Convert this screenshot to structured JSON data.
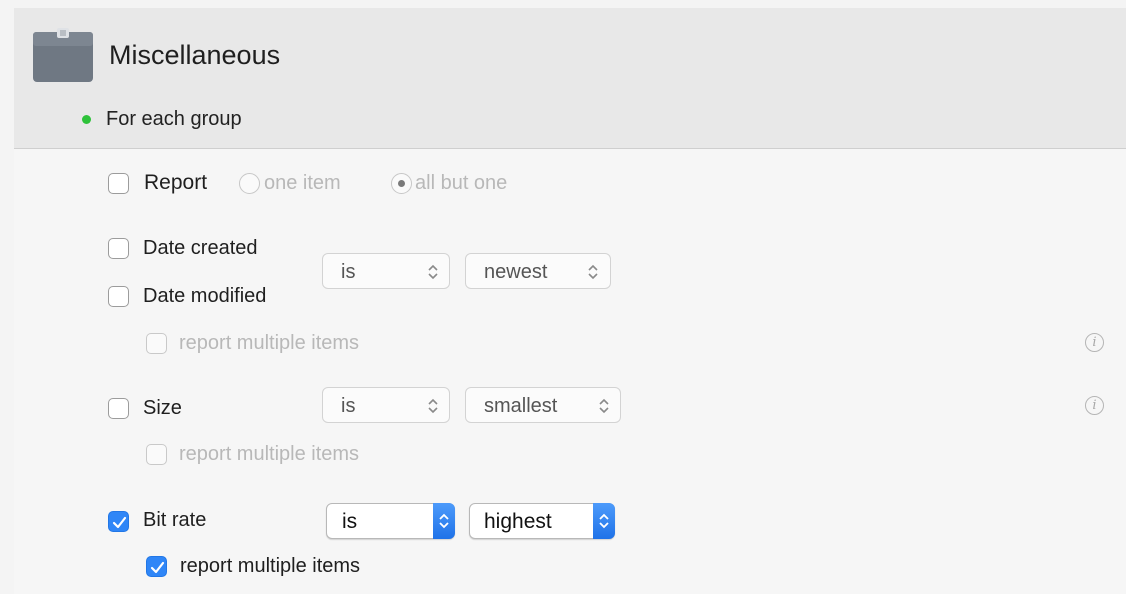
{
  "section": {
    "title": "Miscellaneous",
    "icon": "folder-icon",
    "status_color": "#2ec23a",
    "group_label": "For each group"
  },
  "report": {
    "label": "Report",
    "checked": false,
    "options": [
      "one item",
      "all but one"
    ],
    "selected": "all but one"
  },
  "dates": {
    "created_label": "Date created",
    "modified_label": "Date modified",
    "operator": "is",
    "value": "newest",
    "multiple_label": "report multiple items",
    "multiple_checked": false
  },
  "size": {
    "label": "Size",
    "operator": "is",
    "value": "smallest",
    "multiple_label": "report multiple items",
    "multiple_checked": false
  },
  "bitrate": {
    "label": "Bit rate",
    "checked": true,
    "operator": "is",
    "value": "highest",
    "multiple_label": "report multiple items",
    "multiple_checked": true
  },
  "info_glyph": "i",
  "accent_color": "#2f86f7"
}
